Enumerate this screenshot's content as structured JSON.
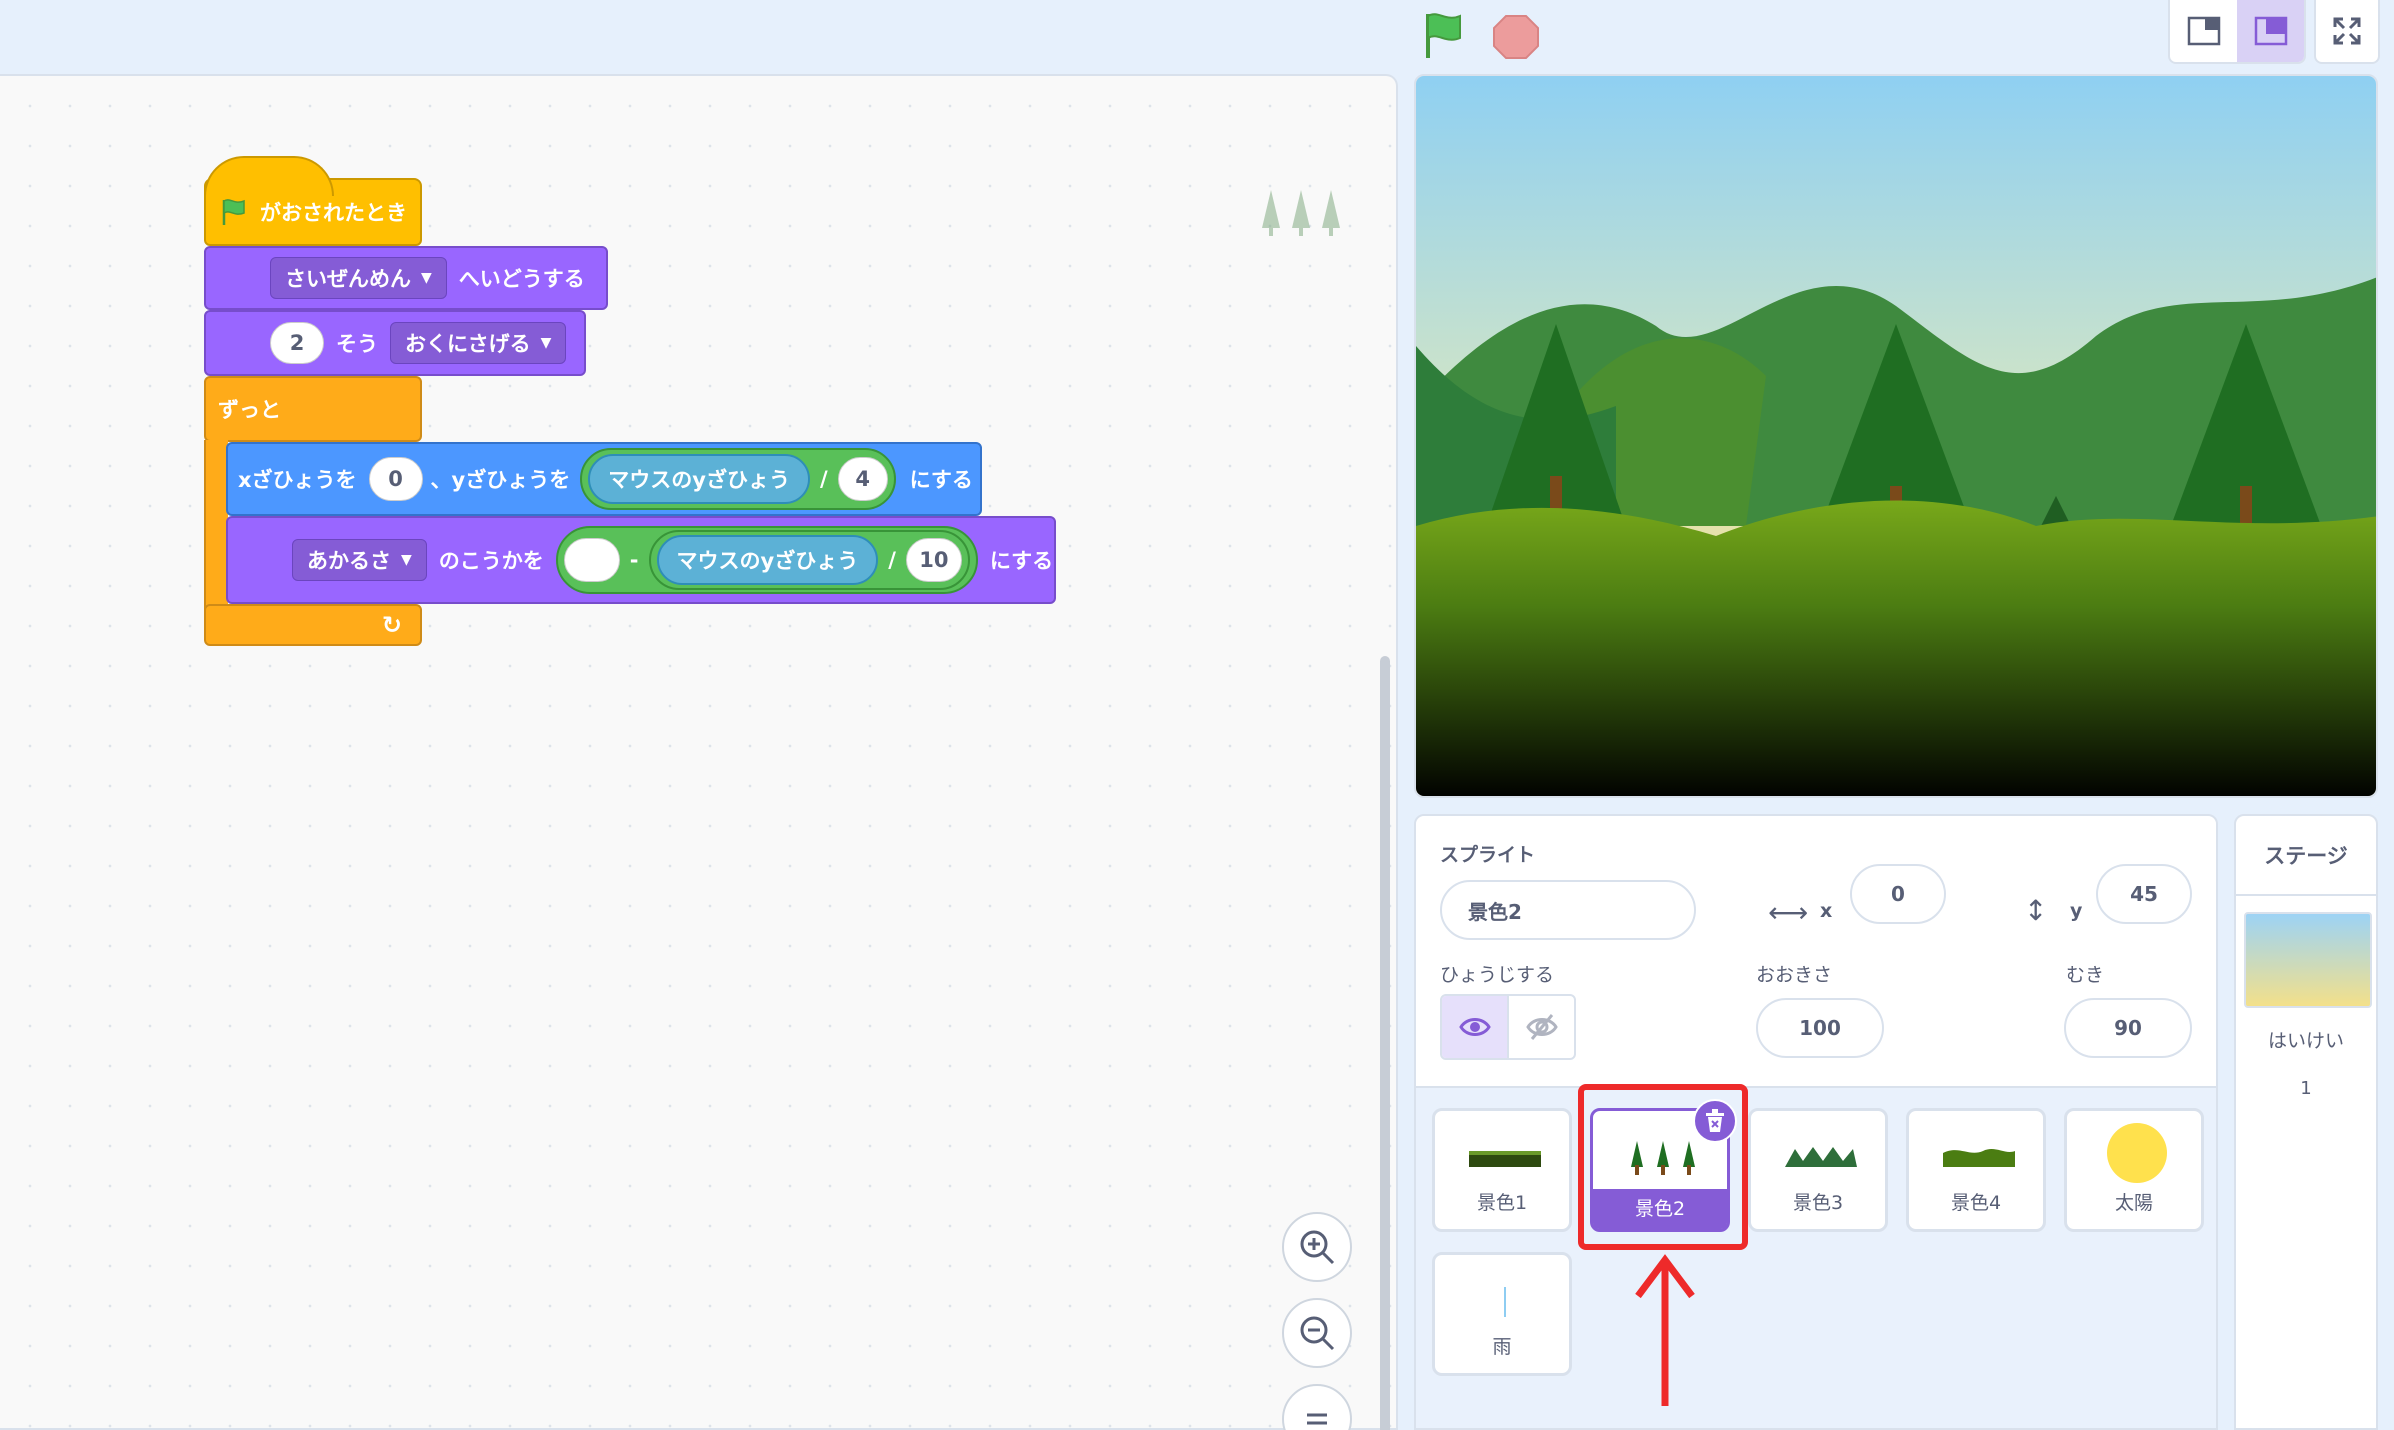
{
  "toolbar": {
    "green_flag": "green-flag",
    "stop": "stop-sign",
    "colors": {
      "flag": "#4cbf56",
      "stop": "#ec9c9c"
    }
  },
  "code": {
    "hat": {
      "label": "がおされたとき"
    },
    "go_to_layer": {
      "menu": "さいぜんめん",
      "suffix": "へいどうする"
    },
    "go_back": {
      "value": "2",
      "middle": "そう",
      "menu": "おくにさげる"
    },
    "forever": {
      "label": "ずっと"
    },
    "goto_xy": {
      "x_label": "xざひょうを",
      "x_value": "0",
      "y_label": "、yざひょうを",
      "reporter": "マウスのyざひょう",
      "divide": "/",
      "divisor": "4",
      "suffix": "にする"
    },
    "set_effect": {
      "menu": "あかるさ",
      "middle": "のこうかを",
      "minus": "-",
      "reporter": "マウスのyざひょう",
      "divide": "/",
      "divisor": "10",
      "suffix": "にする"
    }
  },
  "sprite_info": {
    "heading": "スプライト",
    "name": "景色2",
    "x_label": "x",
    "x": "0",
    "y_label": "y",
    "y": "45",
    "show_label": "ひょうじする",
    "size_label": "おおきさ",
    "size": "100",
    "direction_label": "むき",
    "direction": "90"
  },
  "sprites": [
    {
      "name": "景色1",
      "selected": false
    },
    {
      "name": "景色2",
      "selected": true
    },
    {
      "name": "景色3",
      "selected": false
    },
    {
      "name": "景色4",
      "selected": false
    },
    {
      "name": "太陽",
      "selected": false
    },
    {
      "name": "雨",
      "selected": false
    }
  ],
  "stage_panel": {
    "heading": "ステージ",
    "backdrops_label": "はいけい",
    "backdrops_count": "1"
  },
  "annotation": {
    "highlight_color": "#ee2a2a"
  }
}
